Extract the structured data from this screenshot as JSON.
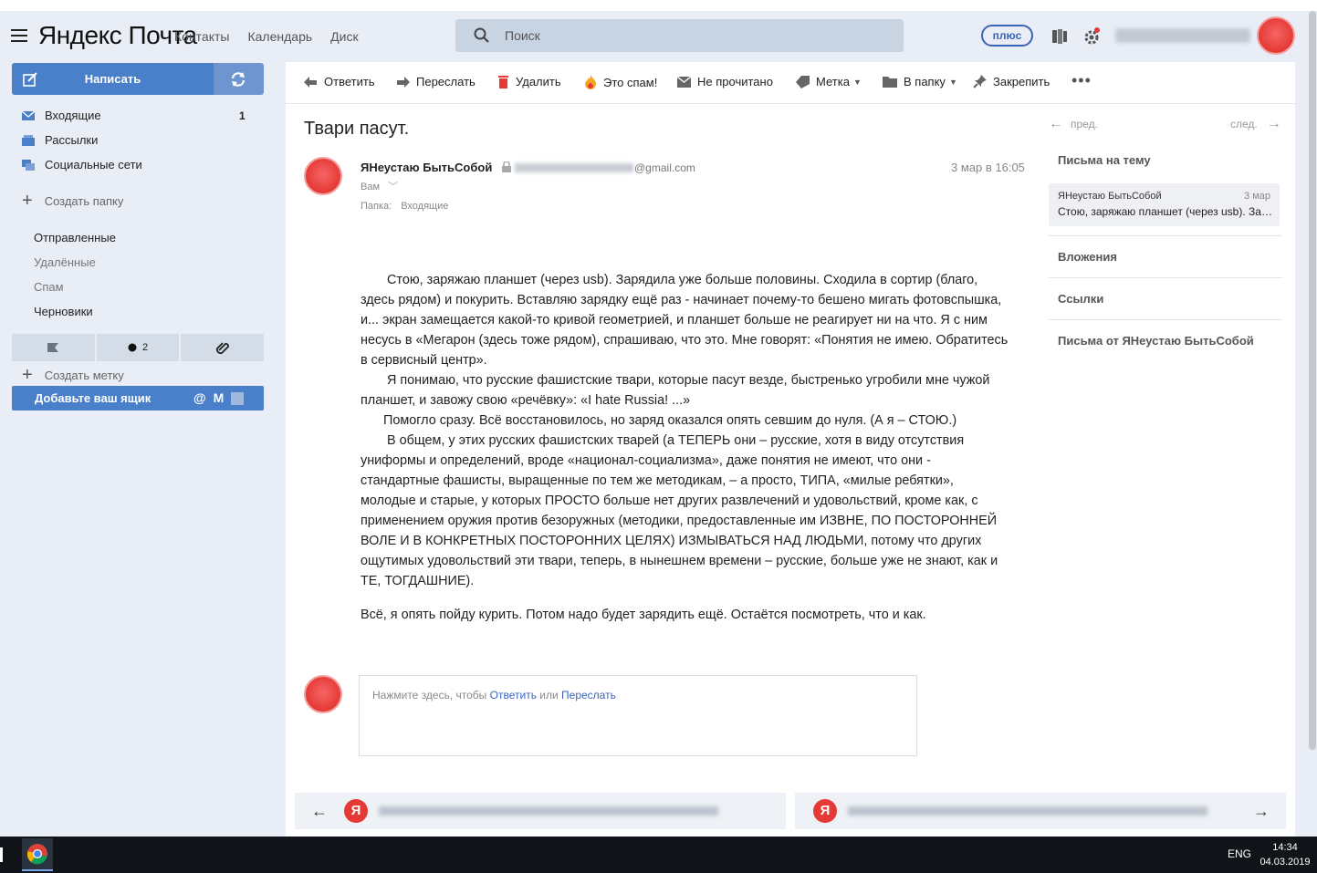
{
  "header": {
    "logo": "Яндекс Почта",
    "nav": [
      "Контакты",
      "Календарь",
      "Диск"
    ],
    "search_placeholder": "Поиск",
    "plus_label": "плюс"
  },
  "sidebar": {
    "compose_label": "Написать",
    "folders": [
      {
        "label": "Входящие",
        "count": "1",
        "icon": "inbox-icon"
      },
      {
        "label": "Рассылки",
        "count": "",
        "icon": "newsletters-icon"
      },
      {
        "label": "Социальные сети",
        "count": "",
        "icon": "social-icon"
      }
    ],
    "create_folder": "Создать папку",
    "sub_folders": [
      {
        "label": "Отправленные",
        "dim": false
      },
      {
        "label": "Удалённые",
        "dim": true
      },
      {
        "label": "Спам",
        "dim": true
      },
      {
        "label": "Черновики",
        "dim": false
      }
    ],
    "filter_unread_count": "2",
    "create_label": "Создать метку",
    "add_mailbox": "Добавьте ваш ящик"
  },
  "toolbar": {
    "reply": "Ответить",
    "forward": "Переслать",
    "delete": "Удалить",
    "spam": "Это спам!",
    "unread": "Не прочитано",
    "label": "Метка",
    "move": "В папку",
    "pin": "Закрепить"
  },
  "message": {
    "subject": "Твари пасут.",
    "sender_name": "ЯНеустаю БытьСобой",
    "sender_domain": "@gmail.com",
    "date": "3 мар в 16:05",
    "to": "Вам",
    "folder_label": "Папка:",
    "folder_value": "Входящие",
    "paragraphs": [
      "Стою, заряжаю планшет (через usb). Зарядила уже больше половины. Сходила в сортир (благо, здесь рядом) и покурить. Вставляю зарядку ещё раз - начинает почему-то бешено мигать фотовспышка, и...  экран замещается какой-то кривой геометрией, и планшет больше не реагирует ни на что. Я с ним несусь в «Мегарон (здесь тоже рядом), спрашиваю, что это. Мне говорят: «Понятия не имею. Обратитесь в сервисный центр».",
      "Я понимаю, что русские фашистские твари, которые пасут везде, быстренько угробили мне чужой планшет, и завожу свою «речёвку»: «I hate Russia! ...»",
      "Помогло сразу. Всё восстановилось, но заряд оказался опять севшим до нуля. (А я – СТОЮ.)",
      "В общем, у этих русских фашистских тварей (а ТЕПЕРЬ они – русские, хотя в виду отсутствия униформы и определений, вроде «национал-социализма», даже понятия не имеют, что они - стандартные фашисты, выращенные по тем же методикам, – а просто, ТИПА, «милые ребятки», молодые и старые, у которых ПРОСТО больше нет других развлечений и удовольствий, кроме как, с применением оружия против безоружных (методики, предоставленные им ИЗВНЕ, ПО ПОСТОРОННЕЙ ВОЛЕ И В КОНКРЕТНЫХ ПОСТОРОННИХ ЦЕЛЯХ) ИЗМЫВАТЬСЯ НАД ЛЮДЬМИ, потому что других ощутимых удовольствий эти твари, теперь, в нынешнем времени – русские, больше уже не знают, как и ТЕ, ТОГДАШНИЕ).",
      "Всё, я опять пойду курить. Потом надо будет зарядить ещё. Остаётся посмотреть, что и как."
    ],
    "reply_prompt_prefix": "Нажмите здесь, чтобы ",
    "reply_prompt_reply": "Ответить",
    "reply_prompt_or": " или ",
    "reply_prompt_forward": "Переслать"
  },
  "right": {
    "prev": "пред.",
    "next": "след.",
    "thread_heading": "Письма на тему",
    "thread_item": {
      "name": "ЯНеустаю БытьСобой",
      "date": "3 мар",
      "snippet": "Стою, заряжаю планшет (через usb). Зарядила уже больше половины."
    },
    "attachments": "Вложения",
    "links": "Ссылки",
    "from_sender": "Письма от ЯНеустаю БытьСобой"
  },
  "taskbar": {
    "lang": "ENG",
    "time": "14:34",
    "date": "04.03.2019"
  },
  "colors": {
    "accent": "#4a7fc9",
    "header_bg": "#e9eef6",
    "avatar_red": "#e53935",
    "link": "#3a64b8"
  }
}
